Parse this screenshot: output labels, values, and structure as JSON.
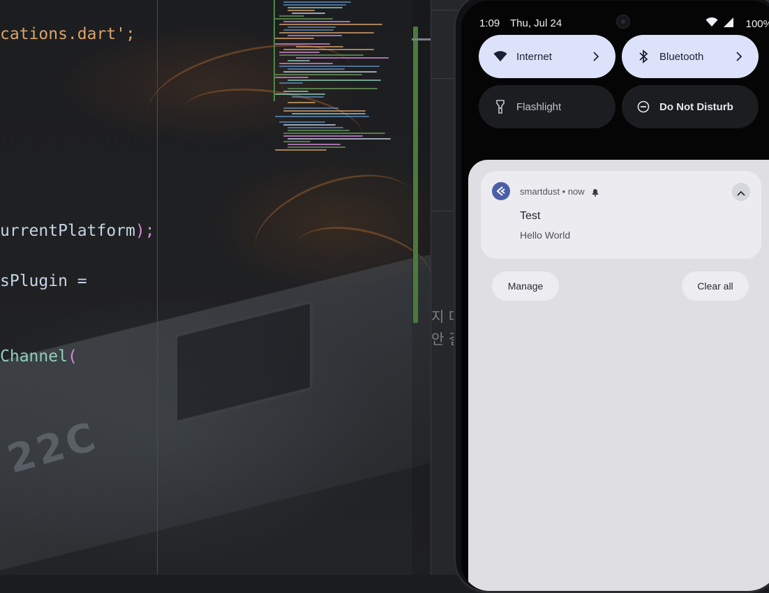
{
  "editor": {
    "code_lines": [
      {
        "text": "cations.dart';",
        "style": "str"
      },
      {
        "text": "urrentPlatform",
        "style": "plain",
        "tail": ");"
      },
      {
        "text": "sPlugin =",
        "style": "plain"
      },
      {
        "text": "Channel",
        "style": "fn",
        "tail": "("
      }
    ],
    "background_badge": "22C"
  },
  "back_window": {
    "snippets": [
      "지 다",
      "안 결"
    ]
  },
  "status_bar": {
    "time": "1:09",
    "date": "Thu, Jul 24",
    "battery": "100%"
  },
  "quick_settings": {
    "tiles": [
      {
        "label": "Internet",
        "icon": "wifi-icon",
        "active": true,
        "has_chevron": true
      },
      {
        "label": "Bluetooth",
        "icon": "bluetooth-icon",
        "active": true,
        "has_chevron": true
      },
      {
        "label": "Flashlight",
        "icon": "flashlight-icon",
        "active": false,
        "has_chevron": false
      },
      {
        "label": "Do Not Disturb",
        "icon": "do-not-disturb-icon",
        "active": false,
        "has_chevron": false
      }
    ]
  },
  "notification": {
    "app_name": "smartdust",
    "time": "now",
    "header": "smartdust • now",
    "title": "Test",
    "body": "Hello World"
  },
  "actions": {
    "manage_label": "Manage",
    "clear_all_label": "Clear all"
  },
  "colors": {
    "qs_active_bg": "#dde2fb",
    "qs_inactive_bg": "#1c1d21",
    "shade_bg": "#dfdfe3",
    "app_icon_bg": "#4a5fa6"
  }
}
